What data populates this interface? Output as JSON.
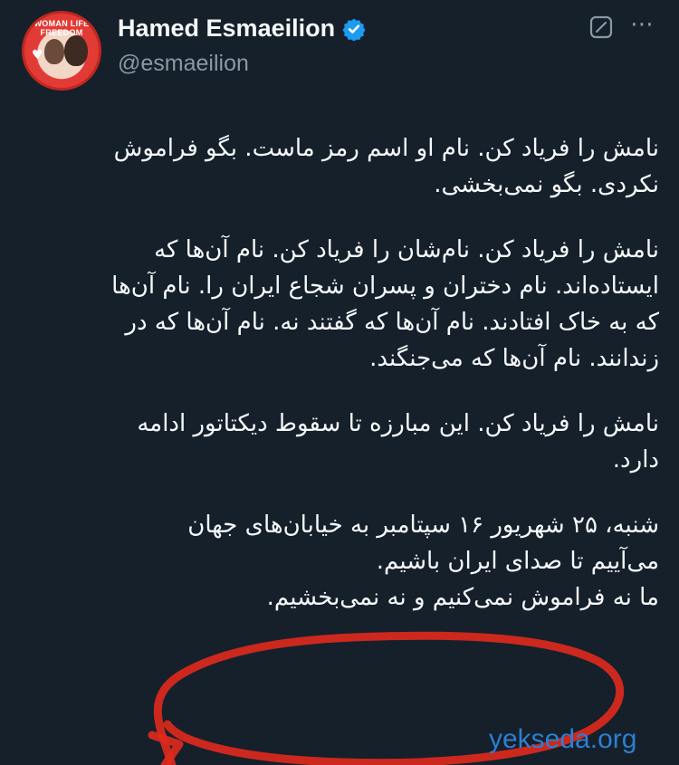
{
  "user": {
    "name": "Hamed Esmaeilion",
    "handle": "@esmaeilion",
    "avatar_text": "WOMAN LIFE FREEDOM"
  },
  "icons": {
    "verified": "verified-badge-icon",
    "grok": "grok-icon",
    "more": "more-icon"
  },
  "colors": {
    "background": "#15202b",
    "verified": "#1d9bf0",
    "scribble": "#e0291d",
    "watermark": "#2c7fd1"
  },
  "tweet": {
    "paragraphs": [
      {
        "lines": [
          "نامش را فریاد کن. نام او اسم رمز ماست. بگو فراموش",
          "نکردی. بگو نمی‌بخشی."
        ]
      },
      {
        "lines": [
          "نامش را فریاد کن. نام‌شان را فریاد کن. نام آن‌ها که",
          "ایستاده‌اند. نام دختران و پسران شجاع ایران را. نام آن‌ها",
          "که به خاک افتادند. نام آن‌ها که گفتند نه. نام آن‌ها که در",
          "زندانند. نام آن‌ها که می‌جنگند."
        ]
      },
      {
        "lines": [
          "نامش را فریاد کن. این مبارزه تا سقوط دیکتاتور ادامه",
          "دارد."
        ]
      },
      {
        "lines": [
          "شنبه، ۲۵ شهریور ۱۶ سپتامبر به خیابان‌های جهان",
          "می‌آییم تا صدای ایران باشیم.",
          "ما نه فراموش نمی‌کنیم و نه نمی‌بخشیم."
        ]
      }
    ]
  },
  "watermark": "yekseda.org"
}
